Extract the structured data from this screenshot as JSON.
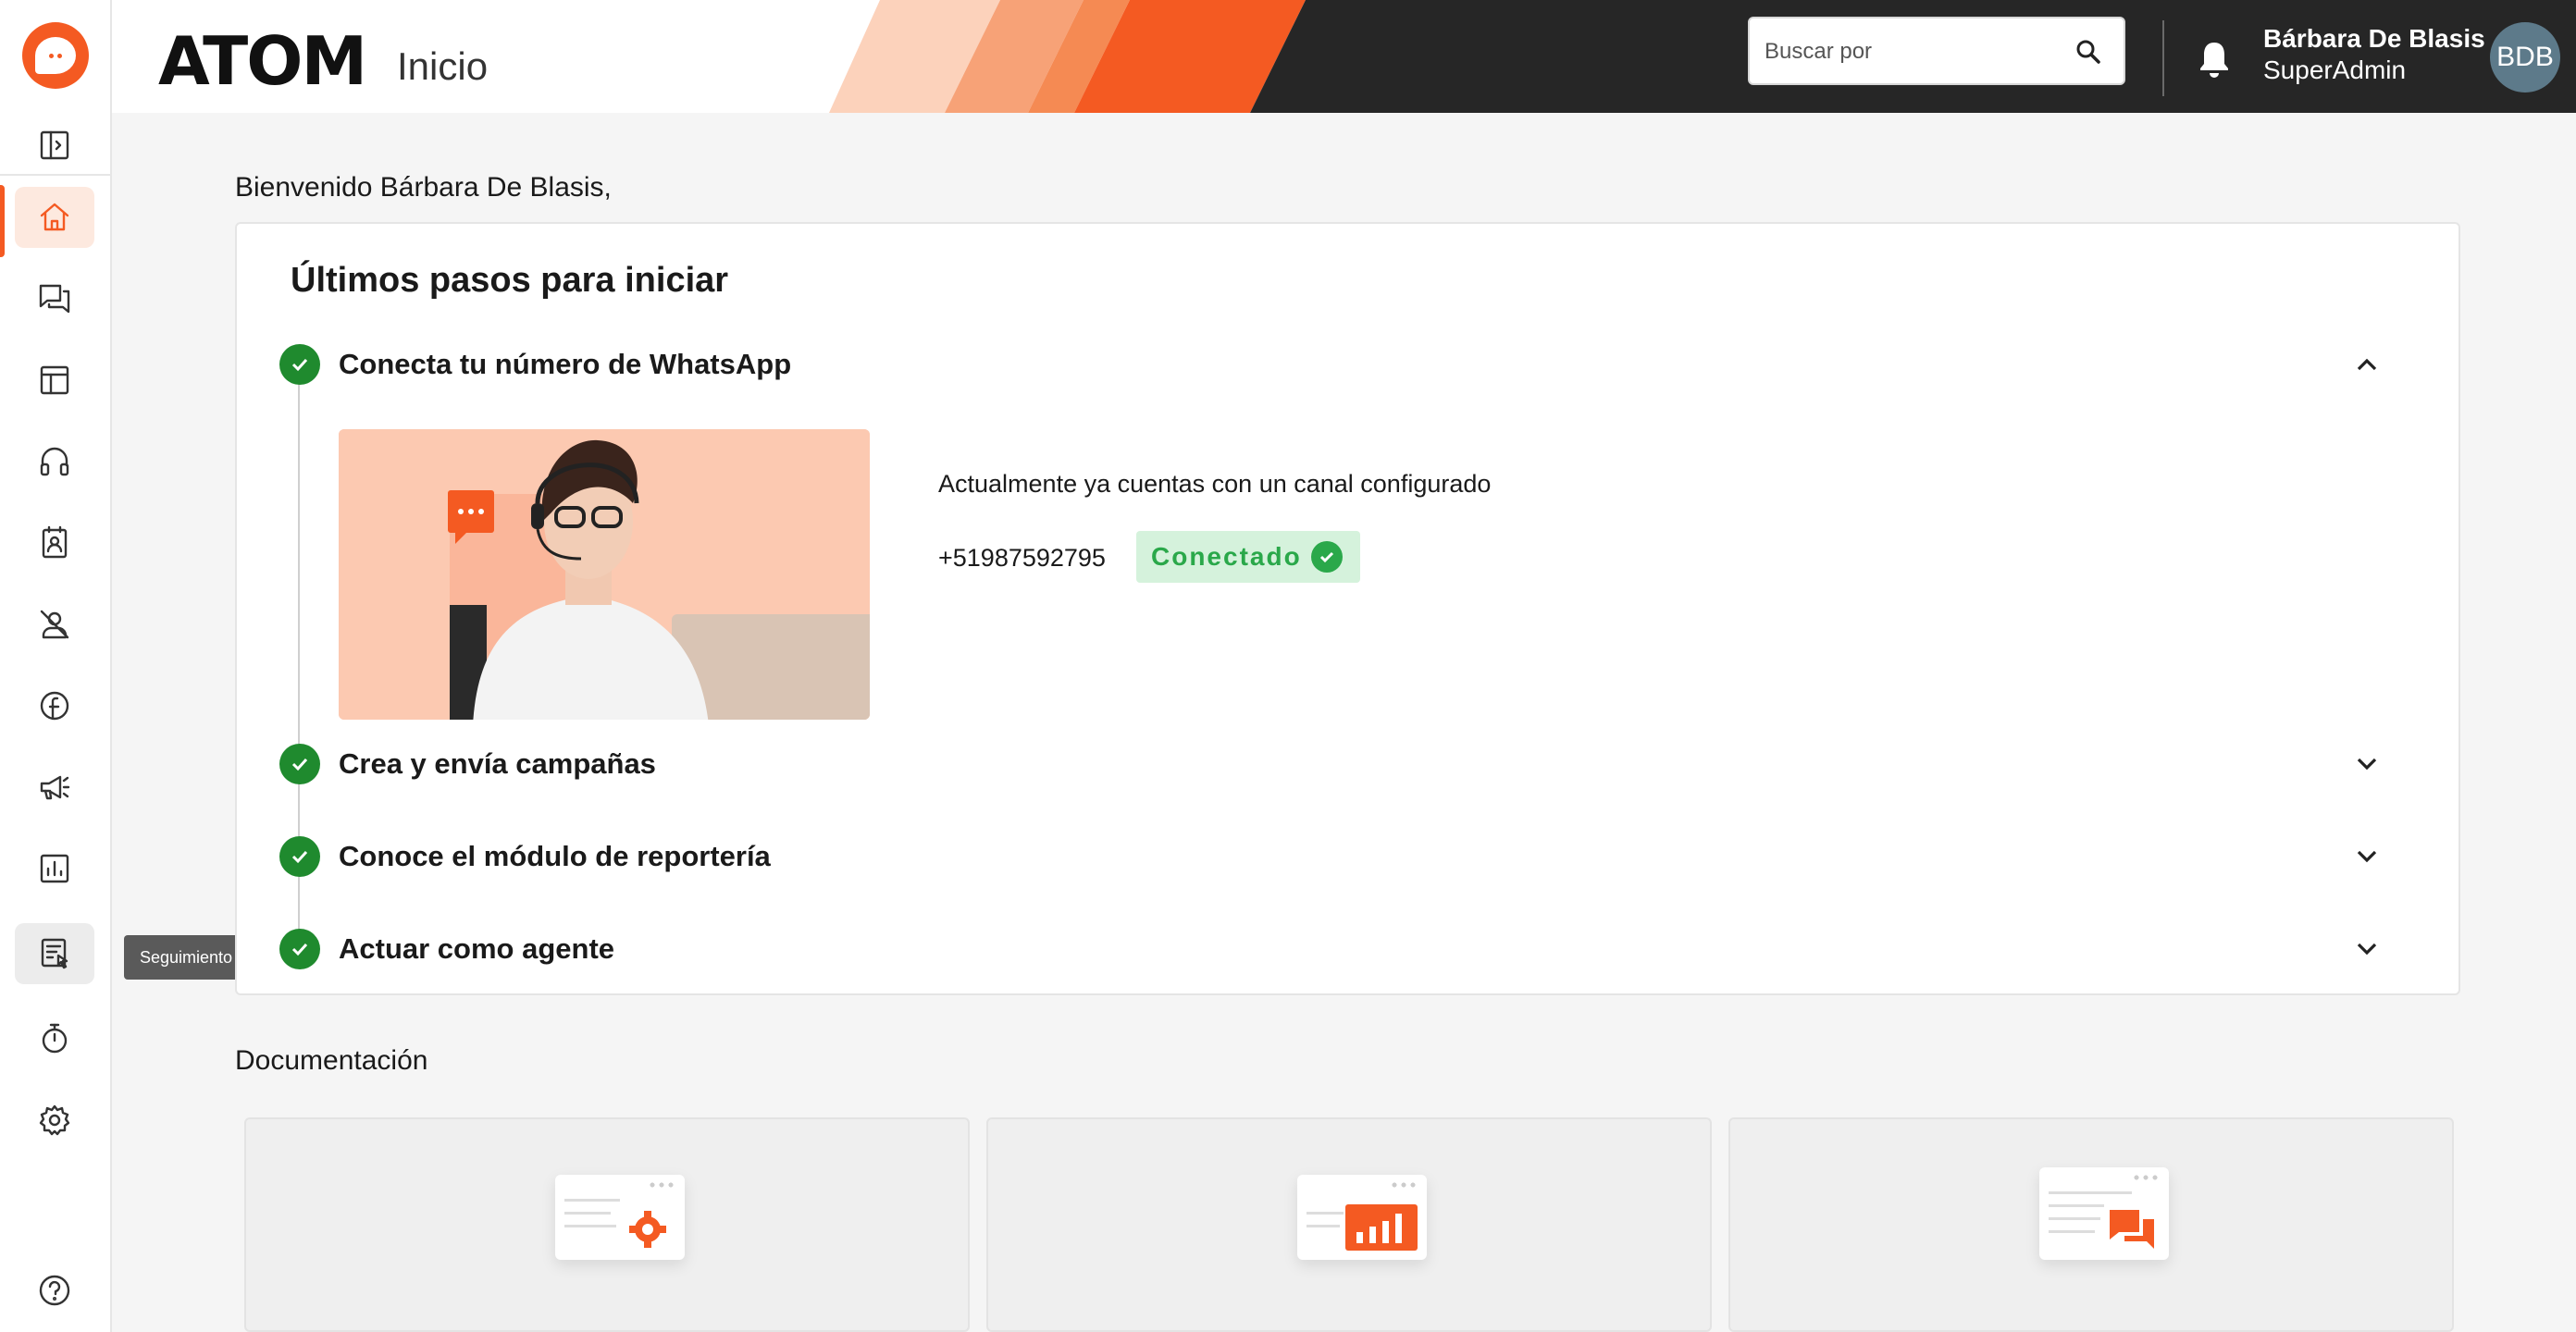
{
  "brand": "ATOM",
  "page_title": "Inicio",
  "search": {
    "placeholder": "Buscar por"
  },
  "user": {
    "name": "Bárbara De Blasis",
    "role": "SuperAdmin",
    "initials": "BDB"
  },
  "sidebar": {
    "items": [
      {
        "icon": "panel-toggle-icon"
      },
      {
        "icon": "home-icon",
        "active": true
      },
      {
        "icon": "chat-bubbles-icon"
      },
      {
        "icon": "table-layout-icon"
      },
      {
        "icon": "headset-icon"
      },
      {
        "icon": "contacts-icon"
      },
      {
        "icon": "agent-off-icon"
      },
      {
        "icon": "facebook-icon"
      },
      {
        "icon": "megaphone-icon"
      },
      {
        "icon": "report-chart-icon"
      },
      {
        "icon": "tracking-icon",
        "hover": true
      },
      {
        "icon": "timer-icon"
      },
      {
        "icon": "settings-icon"
      },
      {
        "icon": "help-icon"
      }
    ],
    "tooltip": "Seguimiento"
  },
  "welcome": "Bienvenido Bárbara De Blasis,",
  "onboarding": {
    "title": "Últimos pasos para iniciar",
    "steps": [
      {
        "label": "Conecta tu número de WhatsApp",
        "expanded": true
      },
      {
        "label": "Crea y envía campañas",
        "expanded": false
      },
      {
        "label": "Conoce el módulo de reportería",
        "expanded": false
      },
      {
        "label": "Actuar como agente",
        "expanded": false
      }
    ],
    "whatsapp": {
      "status_text": "Actualmente ya cuentas con un canal configurado",
      "phone": "+51987592795",
      "badge": "Conectado"
    }
  },
  "documentation": {
    "title": "Documentación"
  },
  "colors": {
    "accent": "#f45a22",
    "success": "#2aa84a",
    "header_dark": "#262626"
  }
}
